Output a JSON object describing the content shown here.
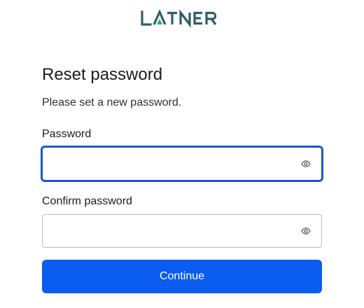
{
  "brand": {
    "logo_text": "LATNER",
    "color": "#2f5d68",
    "accent": "#27b27a"
  },
  "form": {
    "title": "Reset password",
    "subtitle": "Please set a new password.",
    "password": {
      "label": "Password",
      "value": "",
      "placeholder": "",
      "toggle_icon": "eye-icon"
    },
    "confirm_password": {
      "label": "Confirm password",
      "value": "",
      "placeholder": "",
      "toggle_icon": "eye-icon"
    },
    "submit_label": "Continue"
  },
  "colors": {
    "primary": "#0b5cf0",
    "focus": "#1a56c9",
    "border": "#b9bcc0"
  }
}
